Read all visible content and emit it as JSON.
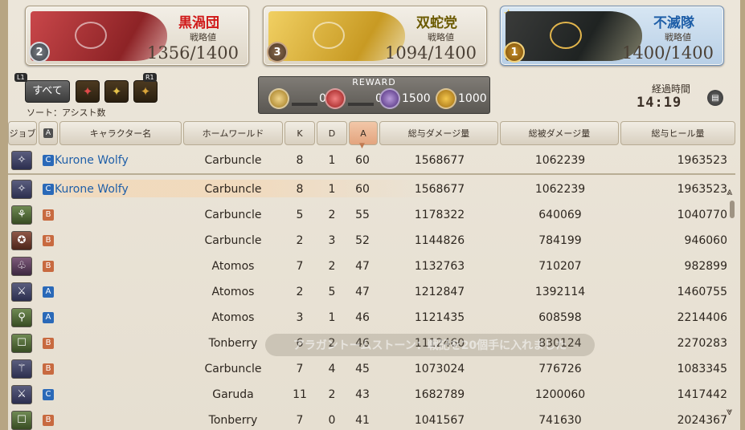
{
  "grand_companies": [
    {
      "name": "黒渦団",
      "label": "戦略値",
      "score": "1356/1400",
      "rank": "2",
      "name_color": "#d01818"
    },
    {
      "name": "双蛇党",
      "label": "戦略値",
      "score": "1094/1400",
      "rank": "3",
      "name_color": "#6b5a00"
    },
    {
      "name": "不滅隊",
      "label": "戦略値",
      "score": "1400/1400",
      "rank": "1",
      "name_color": "#1f5fa8"
    }
  ],
  "filters": {
    "l1": "L1",
    "r1": "R1",
    "all_label": "すべて",
    "sort_label": "ソート：アシスト数"
  },
  "reward": {
    "title": "REWARD",
    "items": [
      "0",
      "0",
      "1500",
      "1000"
    ]
  },
  "elapsed": {
    "label": "経過時間",
    "value": "14:19"
  },
  "columns": {
    "job": "ジョブ",
    "gc": "A",
    "name": "キャラクター名",
    "world": "ホームワールド",
    "k": "K",
    "d": "D",
    "a": "A",
    "dmg": "総与ダメージ量",
    "taken": "総被ダメージ量",
    "heal": "総与ヒール量"
  },
  "self_row": {
    "gc": "C",
    "name": "Kurone Wolfy",
    "world": "Carbuncle",
    "k": "8",
    "d": "1",
    "a": "60",
    "dmg": "1568677",
    "taken": "1062239",
    "heal": "1963523"
  },
  "rows": [
    {
      "gc": "C",
      "name": "Kurone Wolfy",
      "world": "Carbuncle",
      "k": "8",
      "d": "1",
      "a": "60",
      "dmg": "1568677",
      "taken": "1062239",
      "heal": "1963523"
    },
    {
      "gc": "B",
      "name": "",
      "world": "Carbuncle",
      "k": "5",
      "d": "2",
      "a": "55",
      "dmg": "1178322",
      "taken": "640069",
      "heal": "1040770"
    },
    {
      "gc": "B",
      "name": "",
      "world": "Carbuncle",
      "k": "2",
      "d": "3",
      "a": "52",
      "dmg": "1144826",
      "taken": "784199",
      "heal": "946060"
    },
    {
      "gc": "B",
      "name": "",
      "world": "Atomos",
      "k": "7",
      "d": "2",
      "a": "47",
      "dmg": "1132763",
      "taken": "710207",
      "heal": "982899"
    },
    {
      "gc": "A",
      "name": "",
      "world": "Atomos",
      "k": "2",
      "d": "5",
      "a": "47",
      "dmg": "1212847",
      "taken": "1392114",
      "heal": "1460755"
    },
    {
      "gc": "A",
      "name": "",
      "world": "Atomos",
      "k": "3",
      "d": "1",
      "a": "46",
      "dmg": "1121435",
      "taken": "608598",
      "heal": "2214406"
    },
    {
      "gc": "B",
      "name": "",
      "world": "Tonberry",
      "k": "6",
      "d": "2",
      "a": "46",
      "dmg": "1112460",
      "taken": "830124",
      "heal": "2270283"
    },
    {
      "gc": "B",
      "name": "",
      "world": "Carbuncle",
      "k": "7",
      "d": "4",
      "a": "45",
      "dmg": "1073024",
      "taken": "776726",
      "heal": "1083345"
    },
    {
      "gc": "C",
      "name": "",
      "world": "Garuda",
      "k": "11",
      "d": "2",
      "a": "43",
      "dmg": "1682789",
      "taken": "1200060",
      "heal": "1417442"
    },
    {
      "gc": "B",
      "name": "",
      "world": "Tonberry",
      "k": "7",
      "d": "0",
      "a": "41",
      "dmg": "1041567",
      "taken": "741630",
      "heal": "2024367"
    }
  ],
  "toast": "アラガントームストーン：戦記を20個手に入れました"
}
